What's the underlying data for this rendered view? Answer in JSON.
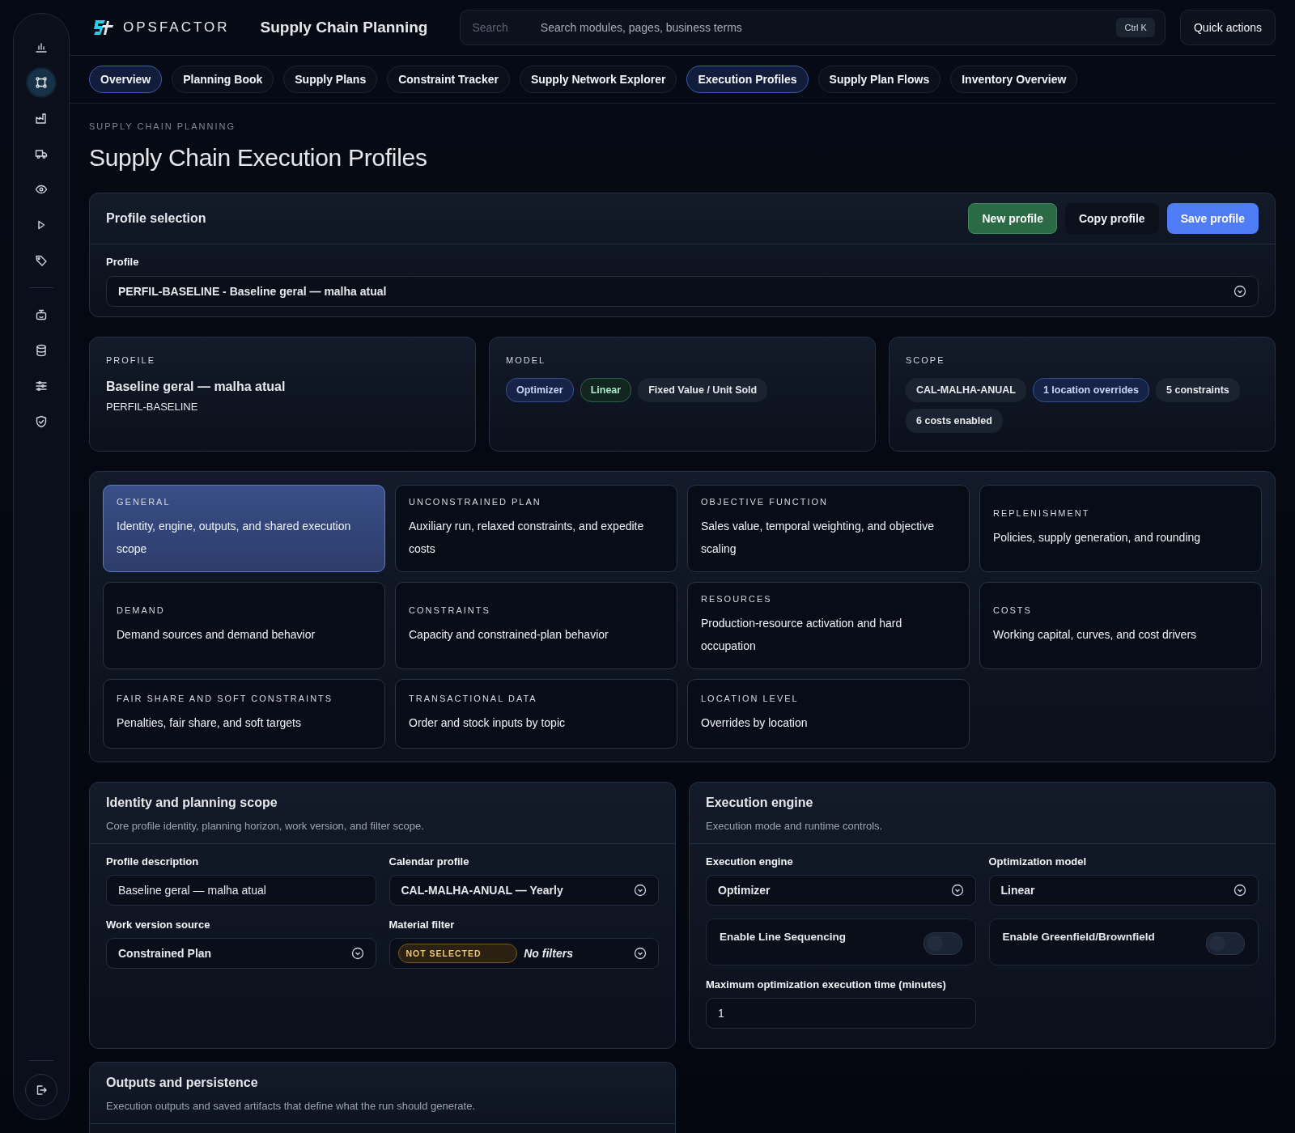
{
  "brand": {
    "name": "OPSFACTOR",
    "module": "Supply Chain Planning"
  },
  "search": {
    "label": "Search",
    "placeholder": "Search modules, pages, business terms",
    "shortcut": "Ctrl K"
  },
  "quick_actions": "Quick actions",
  "sidebar": {
    "groups": [
      [
        {
          "selected": false
        },
        {
          "selected": true
        },
        {
          "selected": false
        },
        {
          "selected": false
        },
        {
          "selected": false
        },
        {
          "selected": false
        },
        {
          "selected": false
        }
      ],
      [
        {
          "selected": false
        },
        {
          "selected": false
        },
        {
          "selected": false
        },
        {
          "selected": false
        }
      ]
    ]
  },
  "tabs": [
    {
      "label": "Overview",
      "selected": true
    },
    {
      "label": "Planning Book",
      "selected": false
    },
    {
      "label": "Supply Plans",
      "selected": false
    },
    {
      "label": "Constraint Tracker",
      "selected": false
    },
    {
      "label": "Supply Network Explorer",
      "selected": false
    },
    {
      "label": "Execution Profiles",
      "selected": true
    },
    {
      "label": "Supply Plan Flows",
      "selected": false
    },
    {
      "label": "Inventory Overview",
      "selected": false
    }
  ],
  "breadcrumb": "SUPPLY CHAIN PLANNING",
  "title": "Supply Chain Execution Profiles",
  "profile_selection": {
    "title": "Profile selection",
    "buttons": [
      {
        "label": "New profile",
        "kind": "success"
      },
      {
        "label": "Copy profile",
        "kind": "ghost"
      },
      {
        "label": "Save profile",
        "kind": "primary"
      }
    ],
    "field_label": "Profile",
    "value": "PERFIL-BASELINE - Baseline geral — malha atual"
  },
  "summary": [
    {
      "label": "PROFILE",
      "name": "Baseline geral — malha atual",
      "code": "PERFIL-BASELINE"
    },
    {
      "label": "MODEL",
      "chips": [
        {
          "text": "Optimizer",
          "kind": "info"
        },
        {
          "text": "Linear",
          "kind": "success"
        },
        {
          "text": "Fixed Value / Unit Sold",
          "kind": "neutral"
        }
      ]
    },
    {
      "label": "SCOPE",
      "chips": [
        {
          "text": "CAL-MALHA-ANUAL",
          "kind": "neutral"
        },
        {
          "text": "1 location overrides",
          "kind": "info"
        },
        {
          "text": "5 constraints",
          "kind": "neutral"
        },
        {
          "text": "6 costs enabled",
          "kind": "neutral"
        }
      ]
    }
  ],
  "sections": [
    {
      "title": "GENERAL",
      "desc": "Identity, engine, outputs, and shared execution scope",
      "selected": true
    },
    {
      "title": "UNCONSTRAINED PLAN",
      "desc": "Auxiliary run, relaxed constraints, and expedite costs",
      "selected": false
    },
    {
      "title": "OBJECTIVE FUNCTION",
      "desc": "Sales value, temporal weighting, and objective scaling",
      "selected": false
    },
    {
      "title": "REPLENISHMENT",
      "desc": "Policies, supply generation, and rounding",
      "selected": false
    },
    {
      "title": "DEMAND",
      "desc": "Demand sources and demand behavior",
      "selected": false
    },
    {
      "title": "CONSTRAINTS",
      "desc": "Capacity and constrained-plan behavior",
      "selected": false
    },
    {
      "title": "RESOURCES",
      "desc": "Production-resource activation and hard occupation",
      "selected": false
    },
    {
      "title": "COSTS",
      "desc": "Working capital, curves, and cost drivers",
      "selected": false
    },
    {
      "title": "FAIR SHARE AND SOFT CONSTRAINTS",
      "desc": "Penalties, fair share, and soft targets",
      "selected": false
    },
    {
      "title": "TRANSACTIONAL DATA",
      "desc": "Order and stock inputs by topic",
      "selected": false
    },
    {
      "title": "LOCATION LEVEL",
      "desc": "Overrides by location",
      "selected": false
    }
  ],
  "panels": [
    {
      "title": "Identity and planning scope",
      "subtitle": "Core profile identity, planning horizon, work version, and filter scope.",
      "fields": [
        {
          "kind": "input",
          "label": "Profile description",
          "value": "Baseline geral — malha atual"
        },
        {
          "kind": "select",
          "label": "Calendar profile",
          "value": "CAL-MALHA-ANUAL — Yearly"
        },
        {
          "kind": "select",
          "label": "Work version source",
          "value": "Constrained Plan"
        },
        {
          "kind": "filter",
          "label": "Material filter",
          "badge": "NOT SELECTED",
          "value": "No filters"
        }
      ]
    },
    {
      "title": "Execution engine",
      "subtitle": "Execution mode and runtime controls.",
      "fields": [
        {
          "kind": "select",
          "label": "Execution engine",
          "value": "Optimizer"
        },
        {
          "kind": "select",
          "label": "Optimization model",
          "value": "Linear"
        },
        {
          "kind": "toggle",
          "label": "Enable Line Sequencing",
          "on": false
        },
        {
          "kind": "toggle",
          "label": "Enable Greenfield/Brownfield",
          "on": false
        },
        {
          "kind": "input",
          "label": "Maximum optimization execution time (minutes)",
          "value": "1"
        }
      ]
    },
    {
      "title": "Outputs and persistence",
      "subtitle": "Execution outputs and saved artifacts that define what the run should generate."
    }
  ]
}
